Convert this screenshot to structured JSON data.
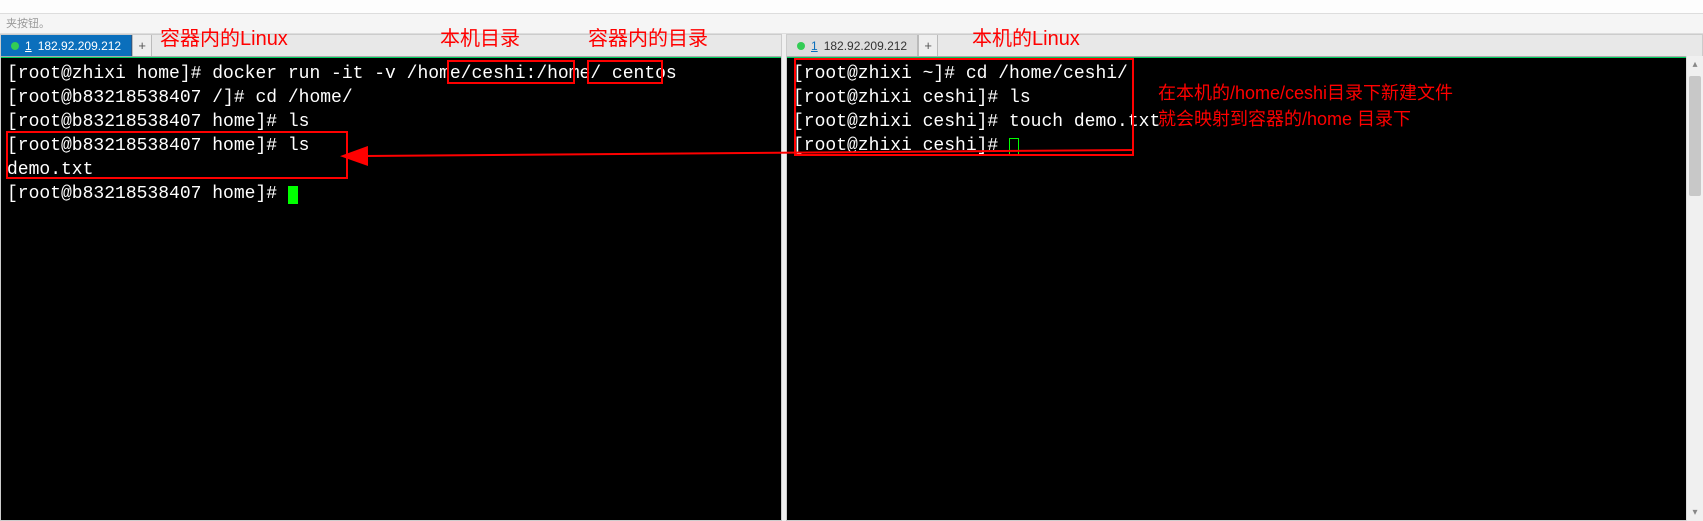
{
  "toolbar_hint": "夹按钮。",
  "annotations": {
    "container_linux": "容器内的Linux",
    "host_dir": "本机目录",
    "container_dir": "容器内的目录",
    "host_linux": "本机的Linux",
    "note_line1": "在本机的/home/ceshi目录下新建文件",
    "note_line2": "就会映射到容器的/home 目录下"
  },
  "tabs": {
    "left": {
      "num": "1",
      "ip": "182.92.209.212"
    },
    "right": {
      "num": "1",
      "ip": "182.92.209.212"
    }
  },
  "left_terminal": {
    "l1a": "[root@zhixi home]# docker run -it -v ",
    "l1b": "/home/ceshi",
    "l1c": ":",
    "l1d": "/home/",
    "l1e": " centos",
    "l2": "[root@b83218538407 /]# cd /home/",
    "l3": "[root@b83218538407 home]# ls",
    "l4": "[root@b83218538407 home]# ls",
    "l5": "demo.txt",
    "l6": "[root@b83218538407 home]# "
  },
  "right_terminal": {
    "r1": "[root@zhixi ~]# cd /home/ceshi/",
    "r2": "[root@zhixi ceshi]# ls",
    "r3": "[root@zhixi ceshi]# touch demo.txt",
    "r4": "[root@zhixi ceshi]# "
  },
  "icons": {
    "plus": "+"
  }
}
